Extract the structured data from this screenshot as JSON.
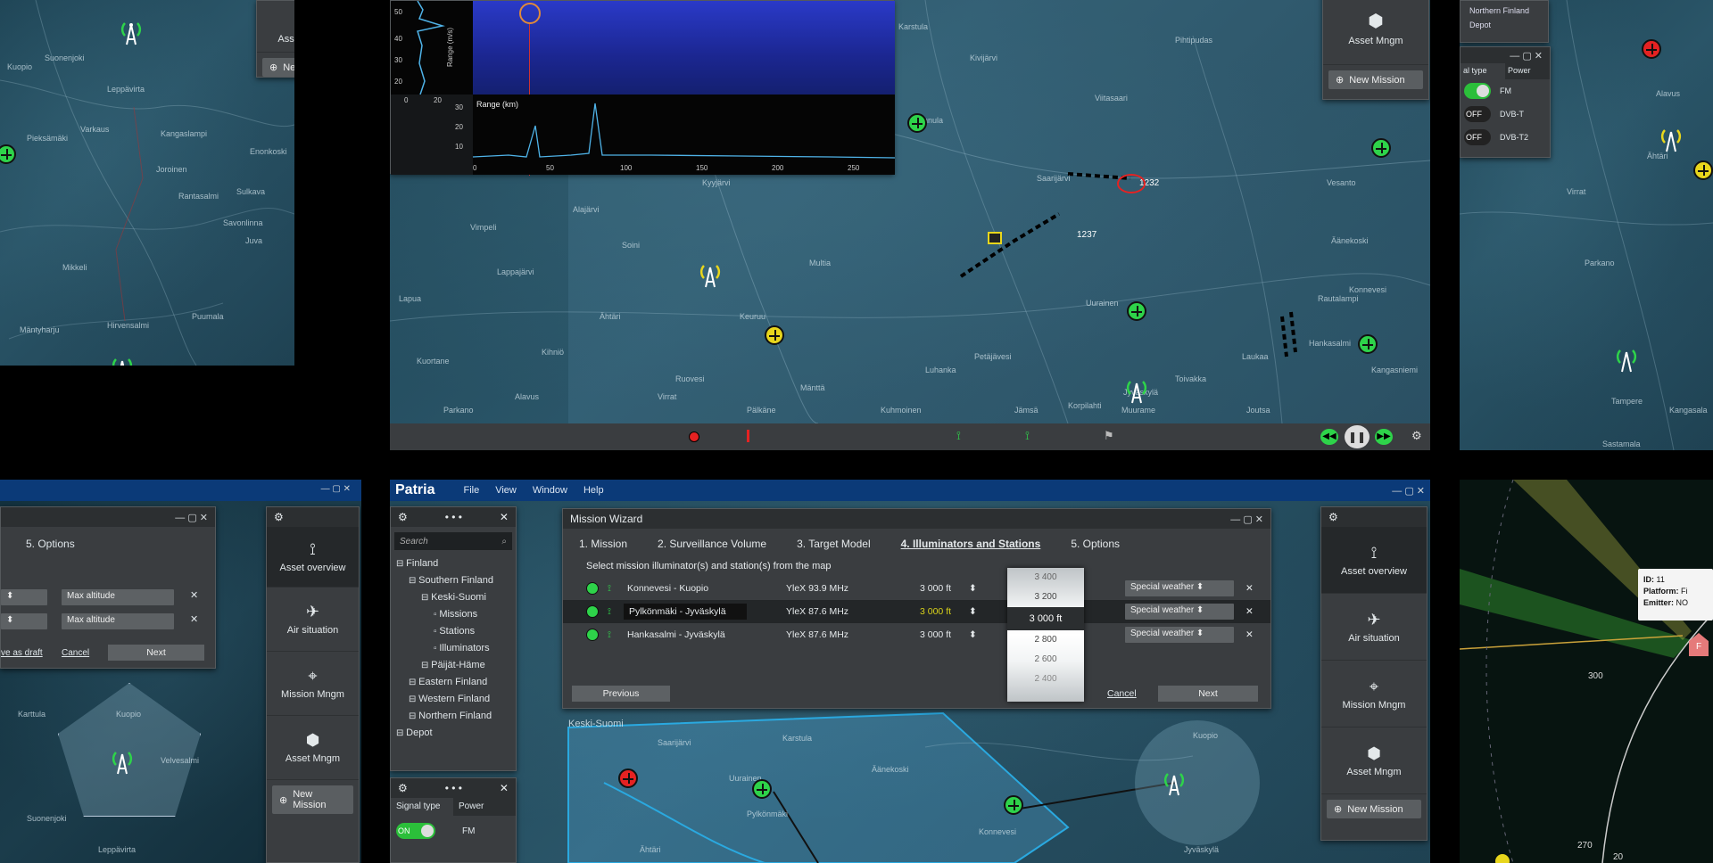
{
  "colors": {
    "accent": "#0b3a78",
    "green": "#2ed34a",
    "red": "#e52222",
    "yellow": "#e8d61c",
    "panel": "#3a3d40"
  },
  "top_left": {
    "towns": [
      "Kuopio",
      "Varkaus",
      "Pieksämäki",
      "Leppävirta",
      "Savonlinna",
      "Joroinen",
      "Mikkeli",
      "Sulkava",
      "Mäntyharju",
      "Suonenjoki",
      "Rantasalmi",
      "Kangaslampi",
      "Juva",
      "Puumala",
      "Hirvensalmi",
      "Enonkoski"
    ],
    "asset_label": "Asset Mngm",
    "new_mission": "New Mission"
  },
  "spectrum": {
    "y_axis_label": "Range (m/s)",
    "x_axis_label": "Range (km)",
    "y_ticks": [
      "50",
      "40",
      "30",
      "20"
    ],
    "left_x_ticks": [
      "0",
      "20"
    ],
    "bottom_y_ticks": [
      "30",
      "20",
      "10"
    ],
    "x_ticks": [
      "0",
      "50",
      "100",
      "150",
      "200",
      "250"
    ]
  },
  "top_center": {
    "towns": [
      "Karstula",
      "Saarijärvi",
      "Alajärvi",
      "Äänekoski",
      "Laukaa",
      "Jyväskylä",
      "Petäjävesi",
      "Keuruu",
      "Multia",
      "Jämsä",
      "Korpilahti",
      "Muurame",
      "Toivakka",
      "Hankasalmi",
      "Konnevesi",
      "Uurainen",
      "Kinnula",
      "Kivijärvi",
      "Viitasaari",
      "Pihtipudas",
      "Rautalampi",
      "Vesanto",
      "Kyyjärvi",
      "Soini",
      "Ähtäri",
      "Virrat",
      "Lappajärvi",
      "Vimpeli",
      "Lapua",
      "Kuortane",
      "Alavus",
      "Kihniö",
      "Parkano",
      "Ruovesi",
      "Mänttä",
      "Kangasniemi",
      "Joutsa",
      "Luhanka",
      "Kuhmoinen",
      "Pälkäne"
    ],
    "tracks": [
      "1237",
      "1232"
    ],
    "new_mission": "New Mission",
    "asset_label": "Asset Mngm"
  },
  "top_right": {
    "panel_title": "Northern Finland",
    "subtitle": "Depot",
    "signal_type": "al type",
    "power": "Power",
    "toggles": [
      {
        "label": "FM",
        "state": "ON"
      },
      {
        "label": "DVB-T",
        "state": "OFF"
      },
      {
        "label": "DVB-T2",
        "state": "OFF"
      }
    ],
    "towns": [
      "Alavus",
      "Ähtäri",
      "Virrat",
      "Parkano",
      "Tampere",
      "Kangasala",
      "Sastamala"
    ]
  },
  "bottom_left": {
    "options_title": "5. Options",
    "altitude_options": [
      "Max altitude",
      "Max altitude"
    ],
    "save_draft": "ve as draft",
    "cancel": "Cancel",
    "next": "Next",
    "side_items": [
      "Asset overview",
      "Air situation",
      "Mission Mngm",
      "Asset Mngm"
    ],
    "new_mission": "New Mission",
    "towns": [
      "Kuopio",
      "Karttula",
      "Velvesalmi",
      "Suonenjoki",
      "Leppävirta"
    ]
  },
  "main_app": {
    "logo": "Patria",
    "menu": [
      "File",
      "View",
      "Window",
      "Help"
    ],
    "search_placeholder": "Search",
    "tree": [
      {
        "label": "Finland",
        "level": 0
      },
      {
        "label": "Southern Finland",
        "level": 1
      },
      {
        "label": "Keski-Suomi",
        "level": 2
      },
      {
        "label": "Missions",
        "level": 3
      },
      {
        "label": "Stations",
        "level": 3
      },
      {
        "label": "Illuminators",
        "level": 3
      },
      {
        "label": "Päijät-Häme",
        "level": 2
      },
      {
        "label": "Eastern Finland",
        "level": 1
      },
      {
        "label": "Western Finland",
        "level": 1
      },
      {
        "label": "Northern Finland",
        "level": 1
      },
      {
        "label": "Depot",
        "level": 0
      }
    ],
    "wizard": {
      "title": "Mission Wizard",
      "tabs": [
        "1. Mission",
        "2. Surveillance Volume",
        "3. Target Model",
        "4. Illuminators and Stations",
        "5. Options"
      ],
      "active_tab": 3,
      "instruction": "Select mission illuminator(s) and station(s) from the map",
      "rows": [
        {
          "name": "Konnevesi - Kuopio",
          "freq": "YleX 93.9 MHz",
          "alt": "3 000 ft",
          "weather": "Special weather"
        },
        {
          "name": "Pylkönmäki - Jyväskylä",
          "freq": "YleX 87.6 MHz",
          "alt": "3 000 ft",
          "weather": "Special weather"
        },
        {
          "name": "Hankasalmi - Jyväskylä",
          "freq": "YleX 87.6 MHz",
          "alt": "3 000 ft",
          "weather": "Special weather"
        }
      ],
      "picker": [
        "3 400",
        "3 200",
        "3 000 ft",
        "2 800",
        "2 600",
        "2 400"
      ],
      "previous": "Previous",
      "cancel": "Cancel",
      "next": "Next"
    },
    "side_items": [
      "Asset overview",
      "Air situation",
      "Mission Mngm",
      "Asset Mngm"
    ],
    "new_mission": "New Mission",
    "signal_panel": {
      "signal_type": "Signal type",
      "power": "Power",
      "toggle": "ON",
      "label": "FM"
    },
    "map_label": "Keski-Suomi",
    "towns": [
      "Saarijärvi",
      "Uurainen",
      "Äänekoski",
      "Konnevesi",
      "Kuopio",
      "Jyväskylä",
      "Pylkönmäki",
      "Ähtäri",
      "Karstula"
    ]
  },
  "bottom_right": {
    "popup": {
      "id_label": "ID:",
      "id_value": "11",
      "platform_label": "Platform:",
      "platform_value": "Fi",
      "emitter_label": "Emitter:",
      "emitter_value": "NO"
    },
    "ticks": [
      "300",
      "270",
      "20"
    ]
  }
}
